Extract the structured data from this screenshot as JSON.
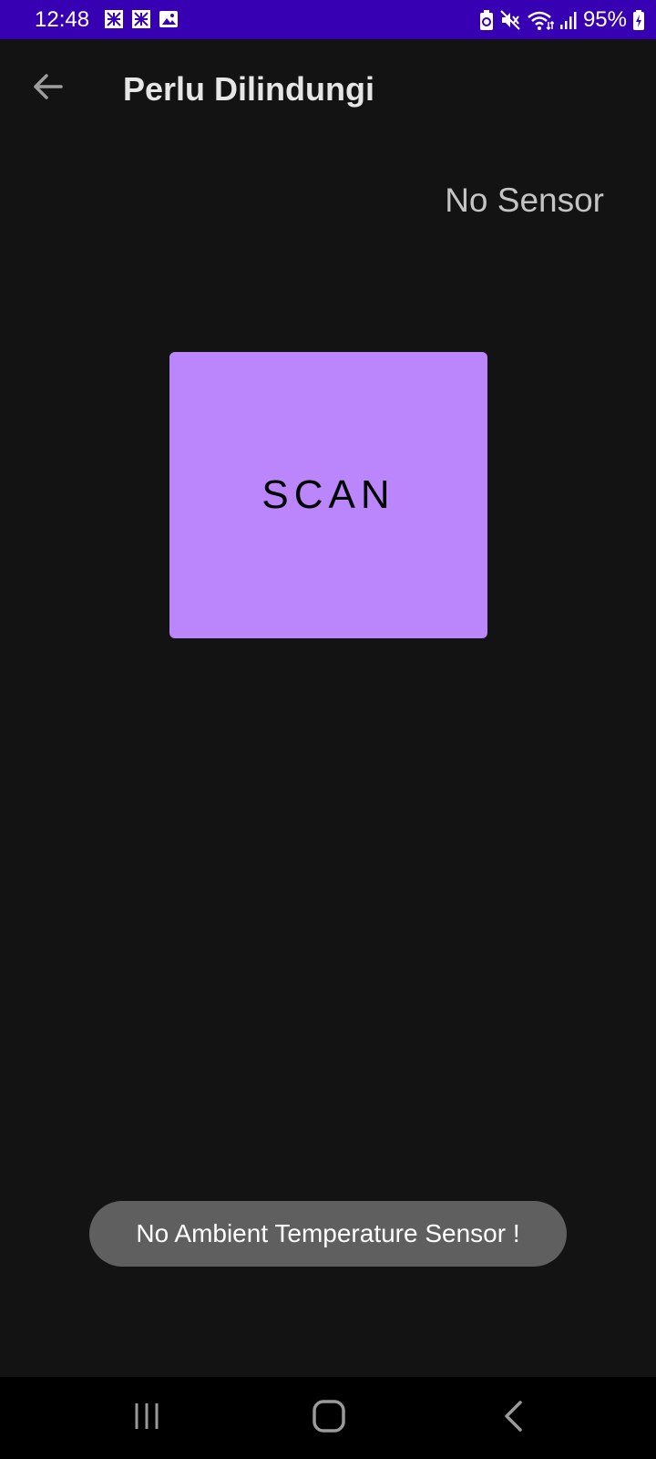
{
  "status_bar": {
    "time": "12:48",
    "battery": "95%",
    "background_color": "#3700b3",
    "left_icons": [
      "news-icon",
      "news-icon",
      "image-icon"
    ],
    "right_icons": [
      "battery-saver-icon",
      "mute-icon",
      "wifi-icon",
      "signal-icon",
      "battery-charging-icon"
    ]
  },
  "app_bar": {
    "title": "Perlu Dilindungi",
    "back_icon": "arrow-back-icon"
  },
  "main": {
    "sensor_status": "No Sensor",
    "scan_label": "SCAN",
    "scan_color": "#bb86fc"
  },
  "toast": {
    "message": "No Ambient Temperature Sensor !"
  },
  "nav_bar": {
    "icons": [
      "recent-apps-icon",
      "home-icon",
      "back-icon"
    ]
  }
}
